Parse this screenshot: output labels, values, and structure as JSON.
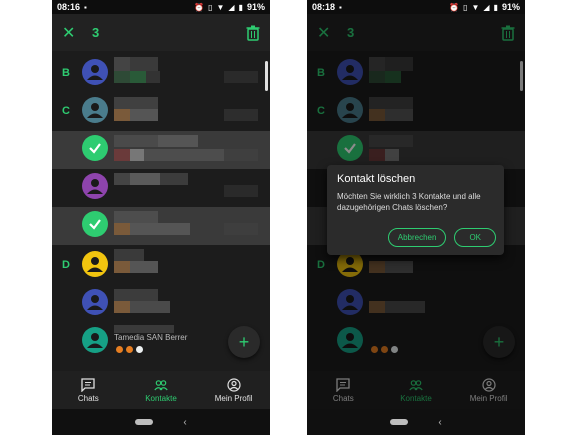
{
  "colors": {
    "accent": "#2ecc71",
    "background": "#1c1c1c",
    "selected_row": "#3a3a3a"
  },
  "left": {
    "status": {
      "time": "08:16",
      "battery": "91%"
    },
    "selection_count": "3"
  },
  "right": {
    "status": {
      "time": "08:18",
      "battery": "91%"
    },
    "selection_count": "3",
    "dialog": {
      "title": "Kontakt löschen",
      "message": "Möchten Sie wirklich 3 Kontakte und alle dazugehörigen Chats löschen?",
      "cancel_label": "Abbrechen",
      "ok_label": "OK"
    }
  },
  "sections": [
    "B",
    "C",
    "D"
  ],
  "partial_contact_name": "Tamedia SAN Berrer",
  "nav": {
    "chats": "Chats",
    "contacts": "Kontakte",
    "profile": "Mein Profil"
  },
  "icons": [
    "close-icon",
    "trash-icon",
    "checkmark-icon",
    "person-icon",
    "add-icon",
    "chat-icon",
    "contacts-icon",
    "profile-icon"
  ]
}
